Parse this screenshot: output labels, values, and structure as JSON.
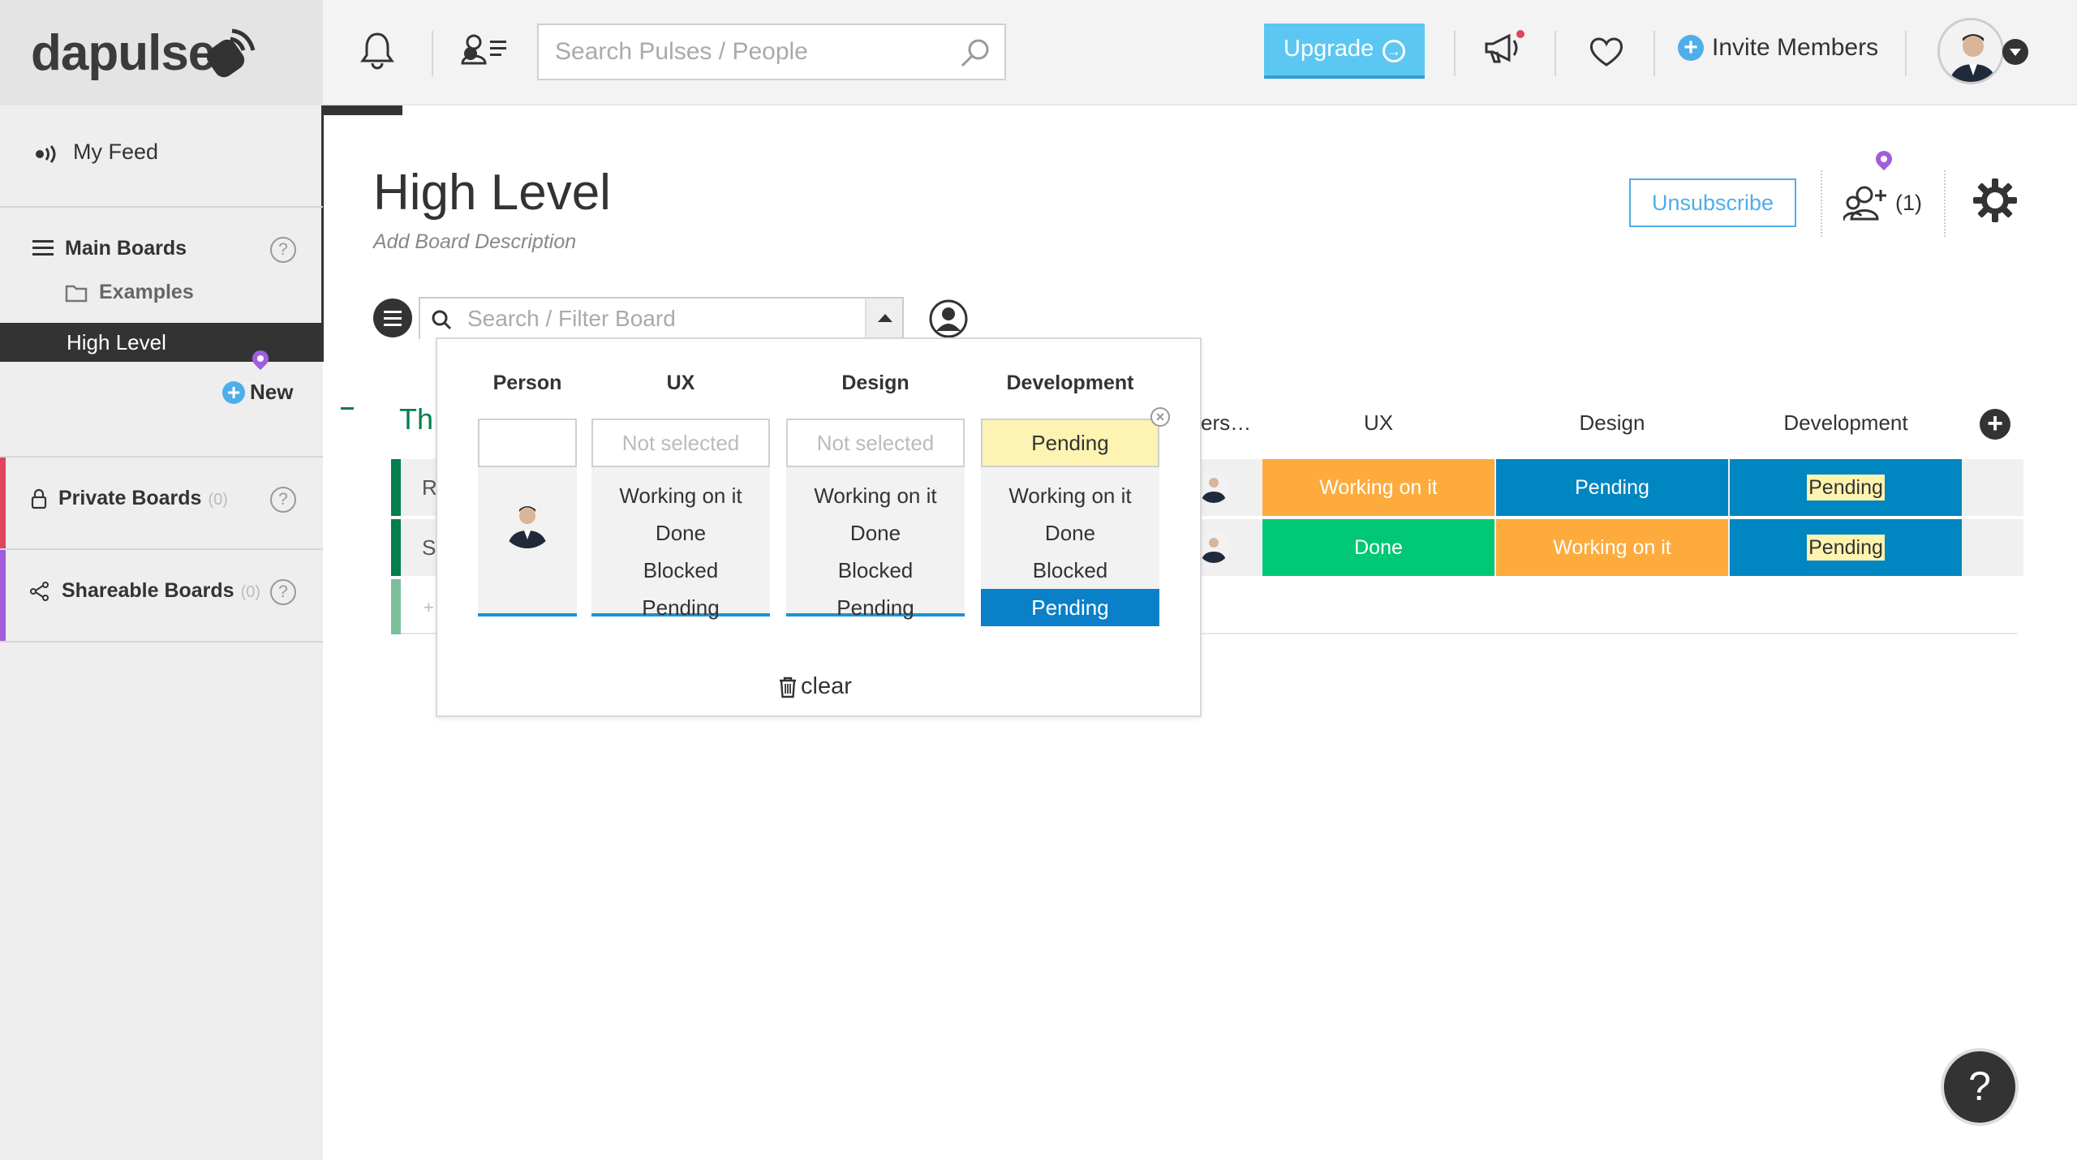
{
  "app": {
    "logo": "dapulse"
  },
  "sidebar": {
    "feed_label": "My Feed",
    "main_boards_label": "Main Boards",
    "folder_label": "Examples",
    "active_board_label": "High Level",
    "new_label": "New",
    "private_boards_label": "Private Boards",
    "private_boards_count": "(0)",
    "shareable_boards_label": "Shareable Boards",
    "shareable_boards_count": "(0)",
    "help_glyph": "?"
  },
  "topbar": {
    "search_placeholder": "Search Pulses / People",
    "upgrade_label": "Upgrade",
    "invite_label": "Invite Members"
  },
  "board": {
    "title": "High Level",
    "description": "Add Board Description",
    "unsubscribe_label": "Unsubscribe",
    "members_count": "(1)",
    "filter_placeholder": "Search / Filter Board"
  },
  "table": {
    "group_name": "Th",
    "columns": {
      "person": "ers…",
      "ux": "UX",
      "design": "Design",
      "development": "Development"
    },
    "rows": [
      {
        "initial": "R",
        "ux": "Working on it",
        "design": "Pending",
        "development": "Pending"
      },
      {
        "initial": "S",
        "ux": "Done",
        "design": "Working on it",
        "development": "Pending"
      }
    ],
    "add_row_glyph": "+"
  },
  "filter_dropdown": {
    "columns": [
      {
        "header": "Person",
        "selected": "",
        "options": []
      },
      {
        "header": "UX",
        "selected": "Not selected",
        "options": [
          "Working on it",
          "Done",
          "Blocked",
          "Pending"
        ]
      },
      {
        "header": "Design",
        "selected": "Not selected",
        "options": [
          "Working on it",
          "Done",
          "Blocked",
          "Pending"
        ]
      },
      {
        "header": "Development",
        "selected": "Pending",
        "options": [
          "Working on it",
          "Done",
          "Blocked",
          "Pending"
        ],
        "active_option": "Pending"
      }
    ],
    "clear_label": "clear"
  },
  "help_fab_glyph": "?",
  "colors": {
    "working_on_it": "#fdab3d",
    "done": "#00c875",
    "pending": "#0086c0",
    "group": "#037f4c",
    "accent_blue": "#4faeea",
    "private_accent": "#e2445c",
    "shareable_accent": "#a25ddc"
  },
  "icons": [
    "bell-icon",
    "people-list-icon",
    "search-icon",
    "arrow-right-circle-icon",
    "megaphone-icon",
    "heart-icon",
    "plus-circle-icon",
    "avatar",
    "caret-down-icon",
    "feed-icon",
    "menu-lines-icon",
    "folder-icon",
    "lock-icon",
    "share-icon",
    "pin-icon",
    "add-member-icon",
    "gear-icon",
    "person-circle-icon",
    "trash-icon"
  ]
}
